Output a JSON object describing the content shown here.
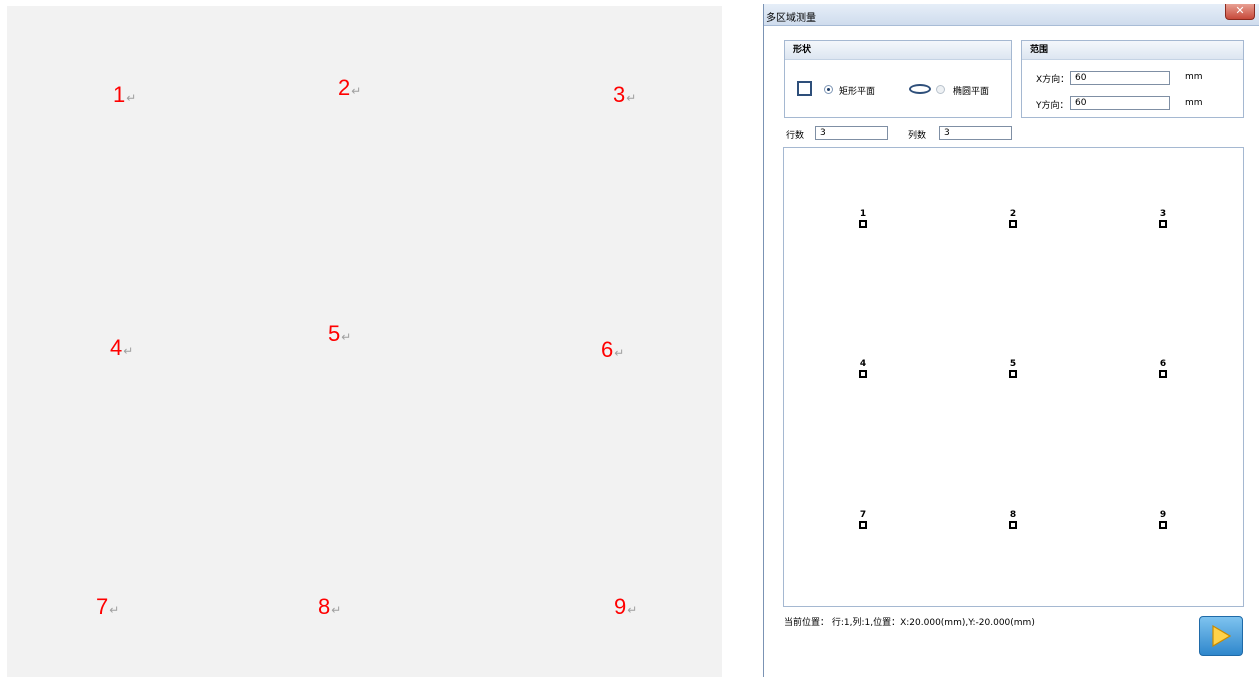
{
  "left_panel": {
    "numbers": [
      "1",
      "2",
      "3",
      "4",
      "5",
      "6",
      "7",
      "8",
      "9"
    ],
    "paragraph_mark": "↵"
  },
  "dialog": {
    "title": "多区域测量",
    "close_label": "✕",
    "shape_group": {
      "title": "形状",
      "rect_label": "矩形平面",
      "ellipse_label": "椭圆平面",
      "selected": "rect"
    },
    "range_group": {
      "title": "范围",
      "x_label": "X方向：",
      "x_value": "60",
      "x_unit": "mm",
      "y_label": "Y方向：",
      "y_value": "60",
      "y_unit": "mm"
    },
    "rows_label": "行数",
    "rows_value": "3",
    "cols_label": "列数",
    "cols_value": "3",
    "points": [
      "1",
      "2",
      "3",
      "4",
      "5",
      "6",
      "7",
      "8",
      "9"
    ],
    "status_text": "当前位置： 行:1,列:1,位置：X:20.000(mm),Y:-20.000(mm)"
  },
  "colors": {
    "doc_number": "#ff0000",
    "accent_border": "#a5b8d1",
    "play_button": "#3a92d4"
  }
}
